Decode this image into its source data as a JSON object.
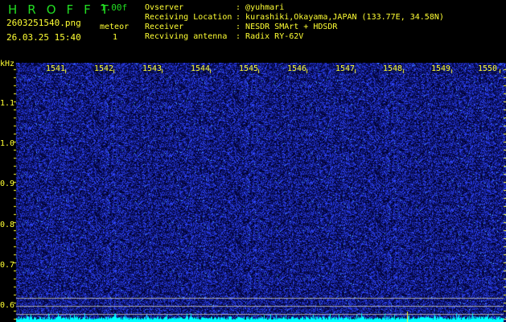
{
  "header": {
    "logo": "HROFFT",
    "version": "1.00f",
    "filename": "2603251540.png",
    "datetime": "26.03.25 15:40",
    "meteor_label": "meteor",
    "meteor_count": "1",
    "info": [
      {
        "label": "Ovserver",
        "value": "@yuhmari"
      },
      {
        "label": "Receiving Location",
        "value": "kurashiki,Okayama,JAPAN (133.77E, 34.58N)"
      },
      {
        "label": "Receiver",
        "value": "NESDR SMArt + HDSDR"
      },
      {
        "label": "Recviving antenna",
        "value": "Radix RY-62V"
      }
    ]
  },
  "axis": {
    "y_unit": "kHz",
    "y_labels": [
      "1.1",
      "1.0",
      "0.9",
      "0.8",
      "0.7",
      "0.6"
    ],
    "x_labels": [
      "1541",
      "1542",
      "1543",
      "1544",
      "1545",
      "1546",
      "1547",
      "1548",
      "1549",
      "1550"
    ]
  },
  "colors": {
    "text": "#ffff33",
    "logo": "#22dd22",
    "spectrum": "#00ffff",
    "noise": "#1a2fff"
  }
}
